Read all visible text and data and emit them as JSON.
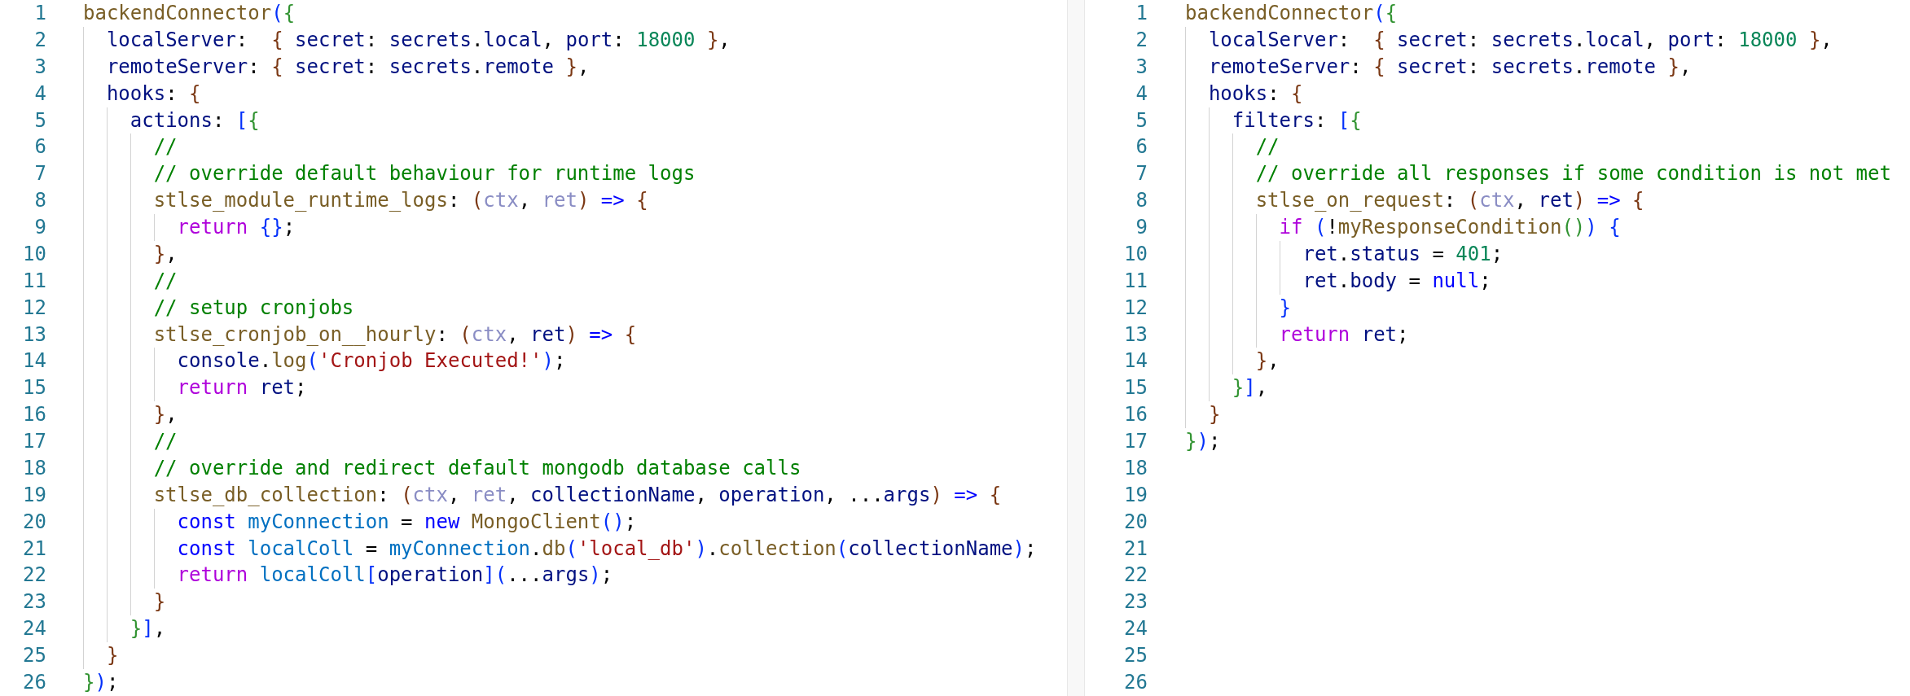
{
  "panes": [
    {
      "line_numbers": [
        "1",
        "2",
        "3",
        "4",
        "5",
        "6",
        "7",
        "8",
        "9",
        "10",
        "11",
        "12",
        "13",
        "14",
        "15",
        "16",
        "17",
        "18",
        "19",
        "20",
        "21",
        "22",
        "23",
        "24",
        "25",
        "26"
      ],
      "lines": [
        {
          "tokens": [
            {
              "kind": "fn",
              "text": "backendConnector"
            },
            {
              "kind": "b1",
              "text": "("
            },
            {
              "kind": "b2",
              "text": "{"
            }
          ],
          "children": [
            {
              "tokens": [
                {
                  "kind": "prop",
                  "text": "localServer"
                },
                {
                  "kind": "p",
                  "text": ":  "
                },
                {
                  "kind": "b3",
                  "text": "{ "
                },
                {
                  "kind": "prop",
                  "text": "secret"
                },
                {
                  "kind": "p",
                  "text": ": "
                },
                {
                  "kind": "prop",
                  "text": "secrets"
                },
                {
                  "kind": "p",
                  "text": "."
                },
                {
                  "kind": "prop",
                  "text": "local"
                },
                {
                  "kind": "p",
                  "text": ", "
                },
                {
                  "kind": "prop",
                  "text": "port"
                },
                {
                  "kind": "p",
                  "text": ": "
                },
                {
                  "kind": "num",
                  "text": "18000 "
                },
                {
                  "kind": "b3",
                  "text": "}"
                },
                {
                  "kind": "p",
                  "text": ","
                }
              ]
            },
            {
              "tokens": [
                {
                  "kind": "prop",
                  "text": "remoteServer"
                },
                {
                  "kind": "p",
                  "text": ": "
                },
                {
                  "kind": "b3",
                  "text": "{ "
                },
                {
                  "kind": "prop",
                  "text": "secret"
                },
                {
                  "kind": "p",
                  "text": ": "
                },
                {
                  "kind": "prop",
                  "text": "secrets"
                },
                {
                  "kind": "p",
                  "text": "."
                },
                {
                  "kind": "prop",
                  "text": "remote "
                },
                {
                  "kind": "b3",
                  "text": "}"
                },
                {
                  "kind": "p",
                  "text": ","
                }
              ]
            },
            {
              "tokens": [
                {
                  "kind": "prop",
                  "text": "hooks"
                },
                {
                  "kind": "p",
                  "text": ": "
                },
                {
                  "kind": "b3",
                  "text": "{"
                }
              ],
              "children": [
                {
                  "tokens": [
                    {
                      "kind": "prop",
                      "text": "actions"
                    },
                    {
                      "kind": "p",
                      "text": ": "
                    },
                    {
                      "kind": "b1",
                      "text": "["
                    },
                    {
                      "kind": "b2",
                      "text": "{"
                    }
                  ],
                  "children": [
                    {
                      "tokens": [
                        {
                          "kind": "cmt",
                          "text": "//"
                        }
                      ]
                    },
                    {
                      "tokens": [
                        {
                          "kind": "cmt",
                          "text": "// override default behaviour for runtime logs"
                        }
                      ]
                    },
                    {
                      "tokens": [
                        {
                          "kind": "fn",
                          "text": "stlse_module_runtime_logs"
                        },
                        {
                          "kind": "p",
                          "text": ": "
                        },
                        {
                          "kind": "b3",
                          "text": "("
                        },
                        {
                          "kind": "dim",
                          "text": "ctx"
                        },
                        {
                          "kind": "p",
                          "text": ", "
                        },
                        {
                          "kind": "dim",
                          "text": "ret"
                        },
                        {
                          "kind": "b3",
                          "text": ") "
                        },
                        {
                          "kind": "st",
                          "text": "=> "
                        },
                        {
                          "kind": "b3",
                          "text": "{"
                        }
                      ],
                      "children": [
                        {
                          "tokens": [
                            {
                              "kind": "kw",
                              "text": "return "
                            },
                            {
                              "kind": "b1",
                              "text": "{}"
                            },
                            {
                              "kind": "p",
                              "text": ";"
                            }
                          ]
                        }
                      ]
                    },
                    {
                      "tokens": [
                        {
                          "kind": "b3",
                          "text": "}"
                        },
                        {
                          "kind": "p",
                          "text": ","
                        }
                      ]
                    },
                    {
                      "tokens": [
                        {
                          "kind": "cmt",
                          "text": "//"
                        }
                      ]
                    },
                    {
                      "tokens": [
                        {
                          "kind": "cmt",
                          "text": "// setup cronjobs"
                        }
                      ]
                    },
                    {
                      "tokens": [
                        {
                          "kind": "fn",
                          "text": "stlse_cronjob_on__hourly"
                        },
                        {
                          "kind": "p",
                          "text": ": "
                        },
                        {
                          "kind": "b3",
                          "text": "("
                        },
                        {
                          "kind": "dim",
                          "text": "ctx"
                        },
                        {
                          "kind": "p",
                          "text": ", "
                        },
                        {
                          "kind": "prop",
                          "text": "ret"
                        },
                        {
                          "kind": "b3",
                          "text": ") "
                        },
                        {
                          "kind": "st",
                          "text": "=> "
                        },
                        {
                          "kind": "b3",
                          "text": "{"
                        }
                      ],
                      "children": [
                        {
                          "tokens": [
                            {
                              "kind": "prop",
                              "text": "console"
                            },
                            {
                              "kind": "p",
                              "text": "."
                            },
                            {
                              "kind": "fn",
                              "text": "log"
                            },
                            {
                              "kind": "b1",
                              "text": "("
                            },
                            {
                              "kind": "str",
                              "text": "'Cronjob Executed!'"
                            },
                            {
                              "kind": "b1",
                              "text": ")"
                            },
                            {
                              "kind": "p",
                              "text": ";"
                            }
                          ]
                        },
                        {
                          "tokens": [
                            {
                              "kind": "kw",
                              "text": "return "
                            },
                            {
                              "kind": "prop",
                              "text": "ret"
                            },
                            {
                              "kind": "p",
                              "text": ";"
                            }
                          ]
                        }
                      ]
                    },
                    {
                      "tokens": [
                        {
                          "kind": "b3",
                          "text": "}"
                        },
                        {
                          "kind": "p",
                          "text": ","
                        }
                      ]
                    },
                    {
                      "tokens": [
                        {
                          "kind": "cmt",
                          "text": "//"
                        }
                      ]
                    },
                    {
                      "tokens": [
                        {
                          "kind": "cmt",
                          "text": "// override and redirect default mongodb database calls"
                        }
                      ]
                    },
                    {
                      "tokens": [
                        {
                          "kind": "fn",
                          "text": "stlse_db_collection"
                        },
                        {
                          "kind": "p",
                          "text": ": "
                        },
                        {
                          "kind": "b3",
                          "text": "("
                        },
                        {
                          "kind": "dim",
                          "text": "ctx"
                        },
                        {
                          "kind": "p",
                          "text": ", "
                        },
                        {
                          "kind": "dim",
                          "text": "ret"
                        },
                        {
                          "kind": "p",
                          "text": ", "
                        },
                        {
                          "kind": "prop",
                          "text": "collectionName"
                        },
                        {
                          "kind": "p",
                          "text": ", "
                        },
                        {
                          "kind": "prop",
                          "text": "operation"
                        },
                        {
                          "kind": "p",
                          "text": ", ..."
                        },
                        {
                          "kind": "prop",
                          "text": "args"
                        },
                        {
                          "kind": "b3",
                          "text": ") "
                        },
                        {
                          "kind": "st",
                          "text": "=> "
                        },
                        {
                          "kind": "b3",
                          "text": "{"
                        }
                      ],
                      "children": [
                        {
                          "tokens": [
                            {
                              "kind": "st",
                              "text": "const "
                            },
                            {
                              "kind": "cv",
                              "text": "myConnection"
                            },
                            {
                              "kind": "p",
                              "text": " = "
                            },
                            {
                              "kind": "st",
                              "text": "new "
                            },
                            {
                              "kind": "fn",
                              "text": "MongoClient"
                            },
                            {
                              "kind": "b1",
                              "text": "()"
                            },
                            {
                              "kind": "p",
                              "text": ";"
                            }
                          ]
                        },
                        {
                          "tokens": [
                            {
                              "kind": "st",
                              "text": "const "
                            },
                            {
                              "kind": "cv",
                              "text": "localColl"
                            },
                            {
                              "kind": "p",
                              "text": " = "
                            },
                            {
                              "kind": "cv",
                              "text": "myConnection"
                            },
                            {
                              "kind": "p",
                              "text": "."
                            },
                            {
                              "kind": "fn",
                              "text": "db"
                            },
                            {
                              "kind": "b1",
                              "text": "("
                            },
                            {
                              "kind": "str",
                              "text": "'local_db'"
                            },
                            {
                              "kind": "b1",
                              "text": ")"
                            },
                            {
                              "kind": "p",
                              "text": "."
                            },
                            {
                              "kind": "fn",
                              "text": "collection"
                            },
                            {
                              "kind": "b1",
                              "text": "("
                            },
                            {
                              "kind": "prop",
                              "text": "collectionName"
                            },
                            {
                              "kind": "b1",
                              "text": ")"
                            },
                            {
                              "kind": "p",
                              "text": ";"
                            }
                          ]
                        },
                        {
                          "tokens": [
                            {
                              "kind": "kw",
                              "text": "return "
                            },
                            {
                              "kind": "cv",
                              "text": "localColl"
                            },
                            {
                              "kind": "b1",
                              "text": "["
                            },
                            {
                              "kind": "prop",
                              "text": "operation"
                            },
                            {
                              "kind": "b1",
                              "text": "]("
                            },
                            {
                              "kind": "p",
                              "text": "..."
                            },
                            {
                              "kind": "prop",
                              "text": "args"
                            },
                            {
                              "kind": "b1",
                              "text": ")"
                            },
                            {
                              "kind": "p",
                              "text": ";"
                            }
                          ]
                        }
                      ]
                    },
                    {
                      "tokens": [
                        {
                          "kind": "b3",
                          "text": "}"
                        }
                      ]
                    }
                  ]
                },
                {
                  "tokens": [
                    {
                      "kind": "b2",
                      "text": "}"
                    },
                    {
                      "kind": "b1",
                      "text": "]"
                    },
                    {
                      "kind": "p",
                      "text": ","
                    }
                  ]
                }
              ]
            },
            {
              "tokens": [
                {
                  "kind": "b3",
                  "text": "}"
                }
              ]
            }
          ]
        },
        {
          "tokens": [
            {
              "kind": "b2",
              "text": "}"
            },
            {
              "kind": "b1",
              "text": ")"
            },
            {
              "kind": "p",
              "text": ";"
            }
          ]
        }
      ]
    },
    {
      "line_numbers": [
        "1",
        "2",
        "3",
        "4",
        "5",
        "6",
        "7",
        "8",
        "9",
        "10",
        "11",
        "12",
        "13",
        "14",
        "15",
        "16",
        "17",
        "18",
        "19",
        "20",
        "21",
        "22",
        "23",
        "24",
        "25",
        "26"
      ],
      "lines": [
        {
          "tokens": [
            {
              "kind": "fn",
              "text": "backendConnector"
            },
            {
              "kind": "b1",
              "text": "("
            },
            {
              "kind": "b2",
              "text": "{"
            }
          ],
          "children": [
            {
              "tokens": [
                {
                  "kind": "prop",
                  "text": "localServer"
                },
                {
                  "kind": "p",
                  "text": ":  "
                },
                {
                  "kind": "b3",
                  "text": "{ "
                },
                {
                  "kind": "prop",
                  "text": "secret"
                },
                {
                  "kind": "p",
                  "text": ": "
                },
                {
                  "kind": "prop",
                  "text": "secrets"
                },
                {
                  "kind": "p",
                  "text": "."
                },
                {
                  "kind": "prop",
                  "text": "local"
                },
                {
                  "kind": "p",
                  "text": ", "
                },
                {
                  "kind": "prop",
                  "text": "port"
                },
                {
                  "kind": "p",
                  "text": ": "
                },
                {
                  "kind": "num",
                  "text": "18000 "
                },
                {
                  "kind": "b3",
                  "text": "}"
                },
                {
                  "kind": "p",
                  "text": ","
                }
              ]
            },
            {
              "tokens": [
                {
                  "kind": "prop",
                  "text": "remoteServer"
                },
                {
                  "kind": "p",
                  "text": ": "
                },
                {
                  "kind": "b3",
                  "text": "{ "
                },
                {
                  "kind": "prop",
                  "text": "secret"
                },
                {
                  "kind": "p",
                  "text": ": "
                },
                {
                  "kind": "prop",
                  "text": "secrets"
                },
                {
                  "kind": "p",
                  "text": "."
                },
                {
                  "kind": "prop",
                  "text": "remote "
                },
                {
                  "kind": "b3",
                  "text": "}"
                },
                {
                  "kind": "p",
                  "text": ","
                }
              ]
            },
            {
              "tokens": [
                {
                  "kind": "prop",
                  "text": "hooks"
                },
                {
                  "kind": "p",
                  "text": ": "
                },
                {
                  "kind": "b3",
                  "text": "{"
                }
              ],
              "children": [
                {
                  "tokens": [
                    {
                      "kind": "prop",
                      "text": "filters"
                    },
                    {
                      "kind": "p",
                      "text": ": "
                    },
                    {
                      "kind": "b1",
                      "text": "["
                    },
                    {
                      "kind": "b2",
                      "text": "{"
                    }
                  ],
                  "children": [
                    {
                      "tokens": [
                        {
                          "kind": "cmt",
                          "text": "//"
                        }
                      ]
                    },
                    {
                      "tokens": [
                        {
                          "kind": "cmt",
                          "text": "// override all responses if some condition is not met"
                        }
                      ]
                    },
                    {
                      "tokens": [
                        {
                          "kind": "fn",
                          "text": "stlse_on_request"
                        },
                        {
                          "kind": "p",
                          "text": ": "
                        },
                        {
                          "kind": "b3",
                          "text": "("
                        },
                        {
                          "kind": "dim",
                          "text": "ctx"
                        },
                        {
                          "kind": "p",
                          "text": ", "
                        },
                        {
                          "kind": "prop",
                          "text": "ret"
                        },
                        {
                          "kind": "b3",
                          "text": ") "
                        },
                        {
                          "kind": "st",
                          "text": "=> "
                        },
                        {
                          "kind": "b3",
                          "text": "{"
                        }
                      ],
                      "children": [
                        {
                          "tokens": [
                            {
                              "kind": "kw",
                              "text": "if "
                            },
                            {
                              "kind": "b1",
                              "text": "("
                            },
                            {
                              "kind": "p",
                              "text": "!"
                            },
                            {
                              "kind": "fn",
                              "text": "myResponseCondition"
                            },
                            {
                              "kind": "b2",
                              "text": "()"
                            },
                            {
                              "kind": "b1",
                              "text": ") {"
                            }
                          ],
                          "children": [
                            {
                              "tokens": [
                                {
                                  "kind": "prop",
                                  "text": "ret"
                                },
                                {
                                  "kind": "p",
                                  "text": "."
                                },
                                {
                                  "kind": "prop",
                                  "text": "status"
                                },
                                {
                                  "kind": "p",
                                  "text": " = "
                                },
                                {
                                  "kind": "num",
                                  "text": "401"
                                },
                                {
                                  "kind": "p",
                                  "text": ";"
                                }
                              ]
                            },
                            {
                              "tokens": [
                                {
                                  "kind": "prop",
                                  "text": "ret"
                                },
                                {
                                  "kind": "p",
                                  "text": "."
                                },
                                {
                                  "kind": "prop",
                                  "text": "body"
                                },
                                {
                                  "kind": "p",
                                  "text": " = "
                                },
                                {
                                  "kind": "st",
                                  "text": "null"
                                },
                                {
                                  "kind": "p",
                                  "text": ";"
                                }
                              ]
                            }
                          ]
                        },
                        {
                          "tokens": [
                            {
                              "kind": "b1",
                              "text": "}"
                            }
                          ]
                        },
                        {
                          "tokens": [
                            {
                              "kind": "kw",
                              "text": "return "
                            },
                            {
                              "kind": "prop",
                              "text": "ret"
                            },
                            {
                              "kind": "p",
                              "text": ";"
                            }
                          ]
                        }
                      ]
                    },
                    {
                      "tokens": [
                        {
                          "kind": "b3",
                          "text": "}"
                        },
                        {
                          "kind": "p",
                          "text": ","
                        }
                      ]
                    }
                  ]
                },
                {
                  "tokens": [
                    {
                      "kind": "b2",
                      "text": "}"
                    },
                    {
                      "kind": "b1",
                      "text": "]"
                    },
                    {
                      "kind": "p",
                      "text": ","
                    }
                  ]
                }
              ]
            },
            {
              "tokens": [
                {
                  "kind": "b3",
                  "text": "}"
                }
              ]
            }
          ]
        },
        {
          "tokens": [
            {
              "kind": "b2",
              "text": "}"
            },
            {
              "kind": "b1",
              "text": ")"
            },
            {
              "kind": "p",
              "text": ";"
            }
          ]
        }
      ]
    }
  ]
}
